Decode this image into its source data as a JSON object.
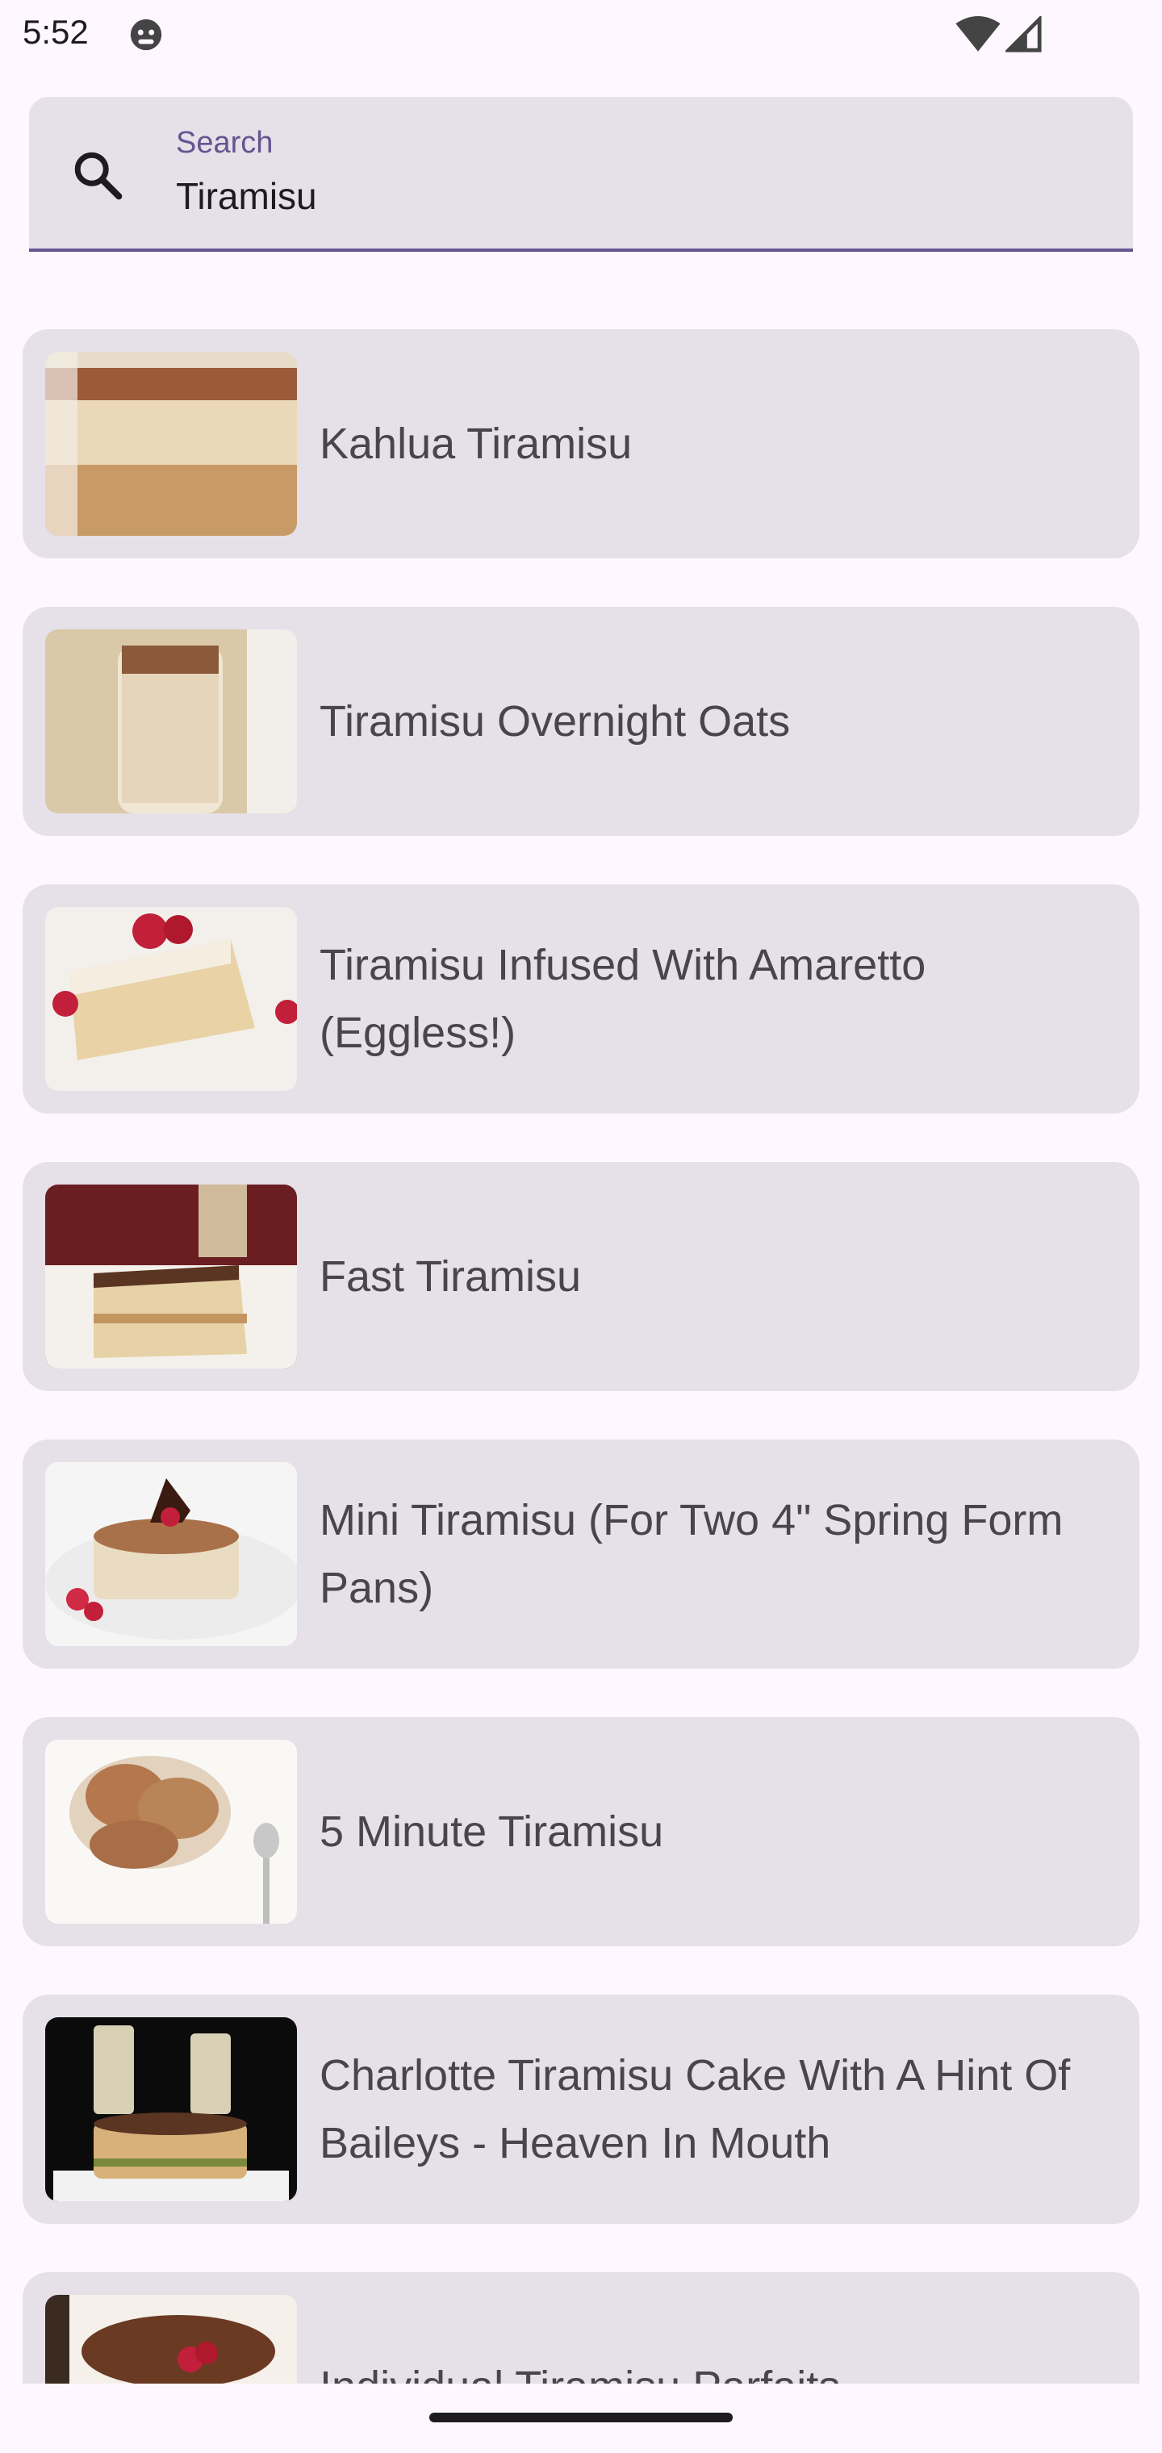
{
  "status_bar": {
    "time": "5:52",
    "icons": [
      "android-debug-icon",
      "wifi-icon",
      "signal-icon"
    ]
  },
  "search": {
    "label": "Search",
    "value": "Tiramisu",
    "icon": "search-icon",
    "accent_color": "#65558F"
  },
  "results": [
    {
      "title": "Kahlua Tiramisu",
      "image": "kahlua-tiramisu-photo"
    },
    {
      "title": "Tiramisu Overnight Oats",
      "image": "overnight-oats-jar-photo"
    },
    {
      "title": "Tiramisu Infused With Amaretto (Eggless!)",
      "image": "amaretto-tiramisu-slice-photo"
    },
    {
      "title": "Fast Tiramisu",
      "image": "fast-tiramisu-slice-photo"
    },
    {
      "title": "Mini Tiramisu (For Two 4\" Spring Form Pans)",
      "image": "mini-tiramisu-photo"
    },
    {
      "title": "5 Minute Tiramisu",
      "image": "five-minute-tiramisu-glass-photo"
    },
    {
      "title": "Charlotte Tiramisu Cake With A Hint Of Baileys - Heaven In Mouth",
      "image": "charlotte-cake-photo"
    },
    {
      "title": "Individual Tiramisu Parfaits",
      "image": "parfait-glass-photo"
    }
  ],
  "colors": {
    "background": "#FEF7FF",
    "card": "#E6E0E9",
    "text": "#49454F"
  }
}
